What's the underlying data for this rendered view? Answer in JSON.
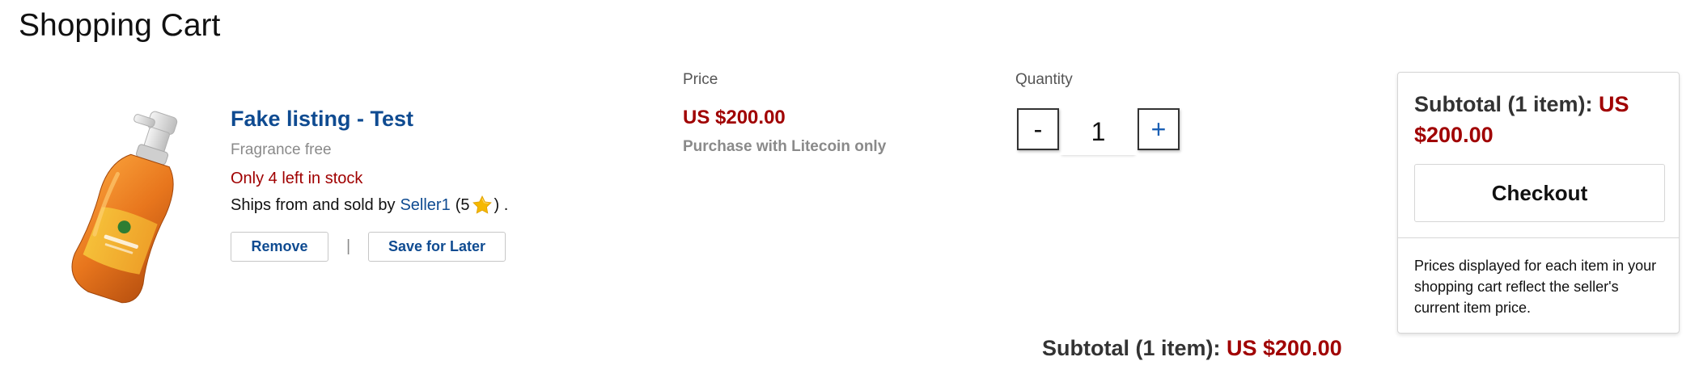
{
  "page": {
    "title": "Shopping Cart"
  },
  "columns": {
    "price_header": "Price",
    "quantity_header": "Quantity"
  },
  "item": {
    "image_icon": "soap-bottle-image",
    "title": "Fake listing - Test",
    "variant": "Fragrance free",
    "stock_warning": "Only 4 left in stock",
    "seller_prefix": "Ships from and sold by",
    "seller_name": "Seller1",
    "rating_open": "(5",
    "rating_icon": "star-icon",
    "rating_close": ") .",
    "remove_label": "Remove",
    "separator": "|",
    "save_later_label": "Save for Later",
    "price": "US $200.00",
    "payment_note": "Purchase with Litecoin only",
    "quantity": "1",
    "minus_label": "-",
    "plus_label": "+"
  },
  "bottom_subtotal": {
    "label": "Subtotal (1 item):",
    "amount": "US $200.00"
  },
  "summary": {
    "subtotal_label": "Subtotal (1 item):",
    "subtotal_amount": "US $200.00",
    "checkout_label": "Checkout",
    "note": "Prices displayed for each item in your shopping cart reflect the seller's current item price."
  },
  "colors": {
    "link_blue": "#0f4b91",
    "price_red": "#a00000",
    "muted_gray": "#8a8a8a",
    "star_yellow": "#f5b800"
  }
}
